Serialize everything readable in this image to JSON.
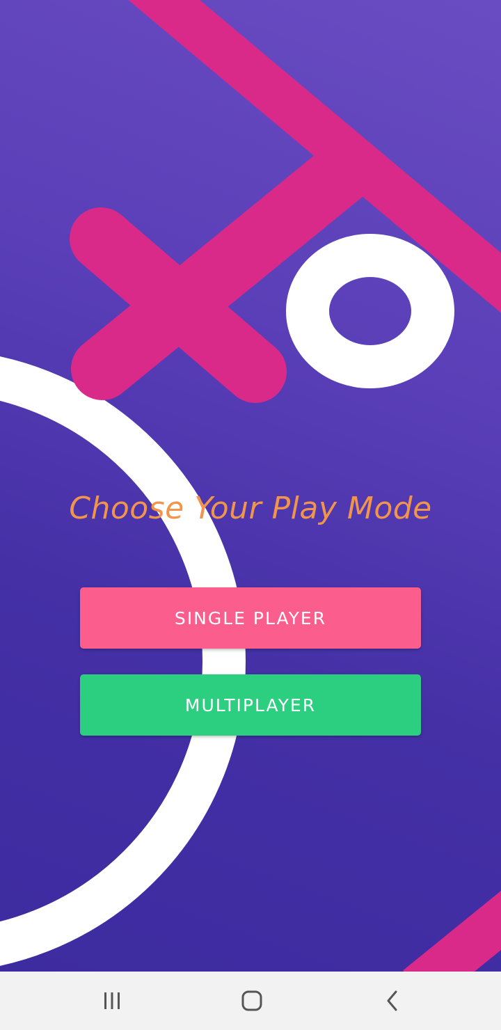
{
  "screen": {
    "title": "Choose Your Play Mode"
  },
  "buttons": {
    "single_player": "SINGLE PLAYER",
    "multiplayer": "MULTIPLAYER"
  },
  "navigation_bar": {
    "recent_apps_icon": "recent-apps-icon",
    "home_icon": "home-icon",
    "back_icon": "back-icon"
  },
  "colors": {
    "background_top": "#6a4cc2",
    "background_bottom": "#3d2ba0",
    "accent_pink": "#d92a8a",
    "title": "#f2954c",
    "single_player_button": "#fb5d8c",
    "multiplayer_button": "#2ccf80",
    "nav_bar": "#f2f2f2"
  }
}
